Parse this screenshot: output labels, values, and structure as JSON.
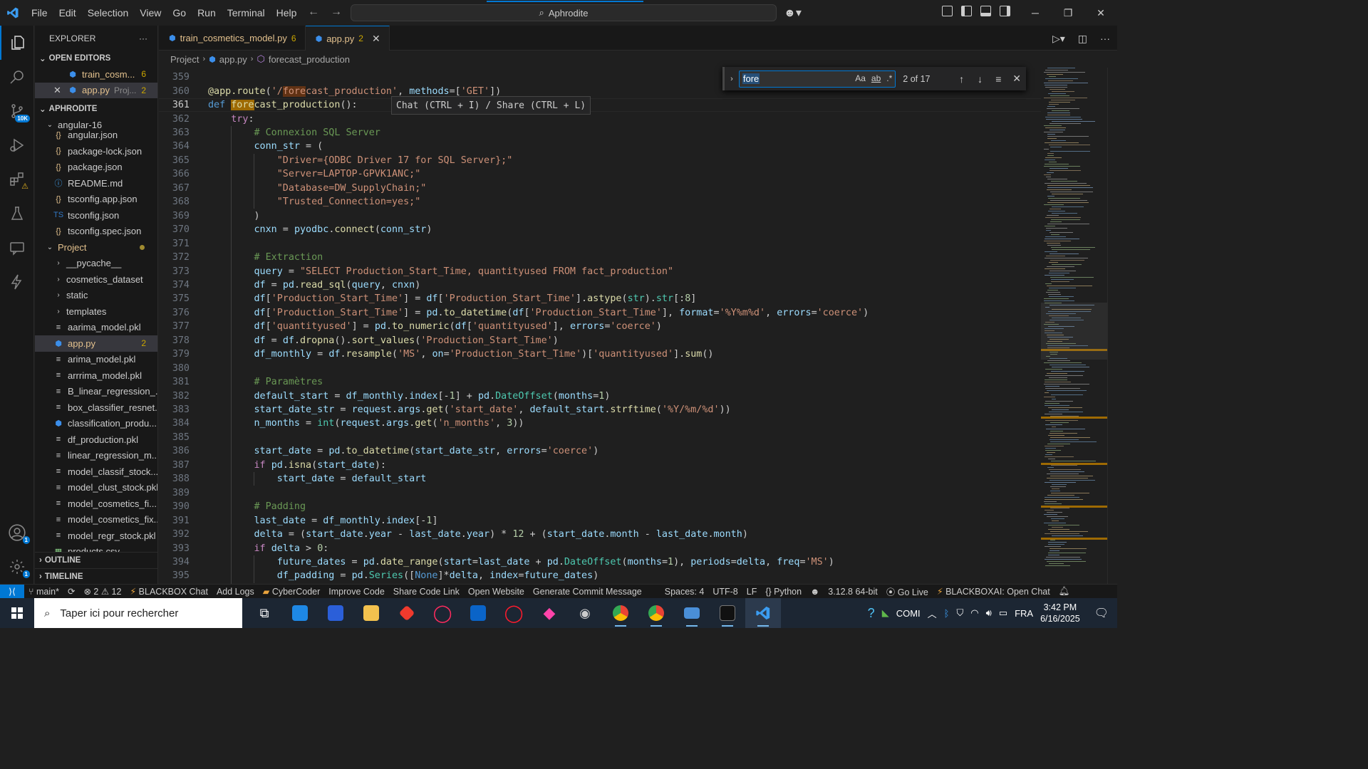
{
  "titlebar": {
    "menus": [
      "File",
      "Edit",
      "Selection",
      "View",
      "Go",
      "Run",
      "Terminal",
      "Help"
    ],
    "command_center": "Aphrodite"
  },
  "activity": {
    "source_control_badge": "10K",
    "accounts_badge": "1",
    "settings_badge": "1"
  },
  "sidebar": {
    "title": "EXPLORER",
    "open_editors_title": "OPEN EDITORS",
    "open_editors": [
      {
        "name": "train_cosm...",
        "count": "6"
      },
      {
        "name": "app.py",
        "path": "Proj...",
        "count": "2"
      }
    ],
    "workspace_title": "APHRODITE",
    "angular_folder": "angular-16",
    "angular_files": [
      "angular.json",
      "package-lock.json",
      "package.json",
      "README.md",
      "tsconfig.app.json",
      "tsconfig.json",
      "tsconfig.spec.json"
    ],
    "project_folder": "Project",
    "project_subfolders": [
      "__pycache__",
      "cosmetics_dataset",
      "static",
      "templates"
    ],
    "project_files": [
      {
        "name": "aarima_model.pkl"
      },
      {
        "name": "app.py",
        "count": "2"
      },
      {
        "name": "arima_model.pkl"
      },
      {
        "name": "arrrima_model.pkl"
      },
      {
        "name": "B_linear_regression_..."
      },
      {
        "name": "box_classifier_resnet..."
      },
      {
        "name": "classification_produ..."
      },
      {
        "name": "df_production.pkl"
      },
      {
        "name": "linear_regression_m..."
      },
      {
        "name": "model_classif_stock...."
      },
      {
        "name": "model_clust_stock.pkl"
      },
      {
        "name": "model_cosmetics_fi..."
      },
      {
        "name": "model_cosmetics_fix..."
      },
      {
        "name": "model_regr_stock.pkl"
      },
      {
        "name": "products.csv"
      }
    ],
    "outline": "OUTLINE",
    "timeline": "TIMELINE"
  },
  "tabs": [
    {
      "label": "train_cosmetics_model.py",
      "count": "6"
    },
    {
      "label": "app.py",
      "count": "2"
    }
  ],
  "breadcrumb": [
    "Project",
    "app.py",
    "forecast_production"
  ],
  "find": {
    "query": "fore",
    "opt_case": "Aa",
    "opt_word": "ab",
    "opt_regex": ".*",
    "matches": "2 of 17"
  },
  "hover_hint": "Chat (CTRL + I) / Share (CTRL + L)",
  "editor": {
    "first_line_number": 359,
    "current_line": 361,
    "lines": [
      "",
      "@app.route('/forecast_production', methods=['GET'])",
      "def forecast_production():",
      "    try:",
      "        # Connexion SQL Server",
      "        conn_str = (",
      "            \"Driver={ODBC Driver 17 for SQL Server};\"",
      "            \"Server=LAPTOP-GPVK1ANC;\"",
      "            \"Database=DW_SupplyChain;\"",
      "            \"Trusted_Connection=yes;\"",
      "        )",
      "        cnxn = pyodbc.connect(conn_str)",
      "",
      "        # Extraction",
      "        query = \"SELECT Production_Start_Time, quantityused FROM fact_production\"",
      "        df = pd.read_sql(query, cnxn)",
      "        df['Production_Start_Time'] = df['Production_Start_Time'].astype(str).str[:8]",
      "        df['Production_Start_Time'] = pd.to_datetime(df['Production_Start_Time'], format='%Y%m%d', errors='coerce')",
      "        df['quantityused'] = pd.to_numeric(df['quantityused'], errors='coerce')",
      "        df = df.dropna().sort_values('Production_Start_Time')",
      "        df_monthly = df.resample('MS', on='Production_Start_Time')['quantityused'].sum()",
      "",
      "        # Paramètres",
      "        default_start = df_monthly.index[-1] + pd.DateOffset(months=1)",
      "        start_date_str = request.args.get('start_date', default_start.strftime('%Y/%m/%d'))",
      "        n_months = int(request.args.get('n_months', 3))",
      "",
      "        start_date = pd.to_datetime(start_date_str, errors='coerce')",
      "        if pd.isna(start_date):",
      "            start_date = default_start",
      "",
      "        # Padding",
      "        last_date = df_monthly.index[-1]",
      "        delta = (start_date.year - last_date.year) * 12 + (start_date.month - last_date.month)",
      "        if delta > 0:",
      "            future_dates = pd.date_range(start=last_date + pd.DateOffset(months=1), periods=delta, freq='MS')",
      "            df_padding = pd.Series([None]*delta, index=future_dates)"
    ]
  },
  "statusbar": {
    "branch": "main*",
    "errors": "2",
    "warnings": "12",
    "items_left": [
      "BLACKBOX Chat",
      "Add Logs",
      "CyberCoder",
      "Improve Code",
      "Share Code Link",
      "Open Website",
      "Generate Commit Message"
    ],
    "spaces": "Spaces: 4",
    "encoding": "UTF-8",
    "eol": "LF",
    "language": "Python",
    "interpreter": "3.12.8 64-bit",
    "golive": "Go Live",
    "blackbox_ai": "BLACKBOXAI: Open Chat"
  },
  "taskbar": {
    "search_placeholder": "Taper ici pour rechercher",
    "tray_label": "COMI",
    "language": "FRA",
    "time": "3:42 PM",
    "date": "6/16/2025"
  },
  "colors": {
    "accent": "#0078d4",
    "editor_bg": "#1f1f1f",
    "sidebar_bg": "#181818",
    "taskbar_bg": "#1c2633"
  }
}
